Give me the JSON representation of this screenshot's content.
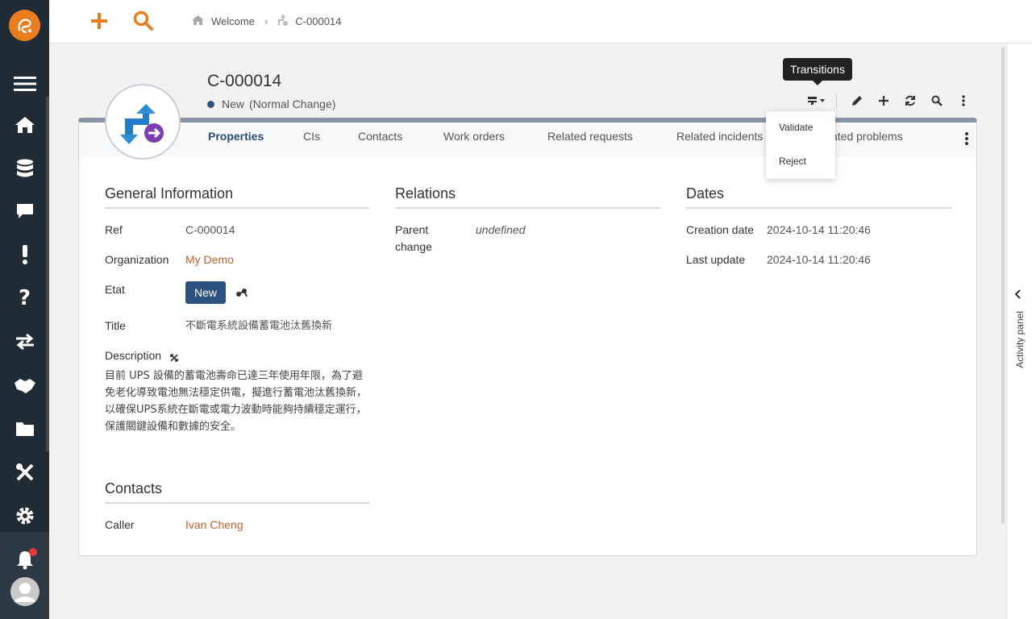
{
  "colors": {
    "sidebar": "#1f2b35",
    "accent": "#ea7d1e",
    "state_blue": "#2c5282",
    "link": "#c0632a"
  },
  "sidebar": {
    "icons": [
      "logo-icon",
      "menu-icon",
      "home-icon",
      "database-icon",
      "chat-icon",
      "exclamation-icon",
      "question-icon",
      "exchange-icon",
      "handshake-icon",
      "folder-icon",
      "tools-icon",
      "gear-icon",
      "bell-icon",
      "avatar-icon"
    ]
  },
  "breadcrumb": {
    "home": "Welcome",
    "current": "C-000014"
  },
  "object": {
    "title": "C-000014",
    "status": "New",
    "type": "(Normal Change)"
  },
  "tooltip": "Transitions",
  "transitions": {
    "validate": "Validate",
    "reject": "Reject"
  },
  "tabs": {
    "properties": "Properties",
    "cis": "CIs",
    "contacts": "Contacts",
    "work_orders": "Work orders",
    "related_requests": "Related requests",
    "related_incidents": "Related incidents",
    "related_problems": "Related problems"
  },
  "general": {
    "heading": "General Information",
    "ref_label": "Ref",
    "ref_value": "C-000014",
    "org_label": "Organization",
    "org_value": "My Demo",
    "etat_label": "Etat",
    "etat_value": "New",
    "title_label": "Title",
    "title_value": "不斷電系統設備蓄電池汰舊換新",
    "desc_label": "Description",
    "desc_value": "目前 UPS 設備的蓄電池壽命已達三年使用年限，為了避免老化導致電池無法穩定供電，擬進行蓄電池汰舊換新，以確保UPS系統在斷電或電力波動時能夠持續穩定運行，保護關鍵設備和數據的安全。"
  },
  "relations": {
    "heading": "Relations",
    "parent_label_1": "Parent",
    "parent_label_2": "change",
    "parent_value": "undefined"
  },
  "dates": {
    "heading": "Dates",
    "created_label": "Creation date",
    "created_value": "2024-10-14 11:20:46",
    "updated_label": "Last update",
    "updated_value": "2024-10-14 11:20:46"
  },
  "contacts": {
    "heading": "Contacts",
    "caller_label": "Caller",
    "caller_value": "Ivan Cheng"
  },
  "activity_panel": "Activity panel"
}
